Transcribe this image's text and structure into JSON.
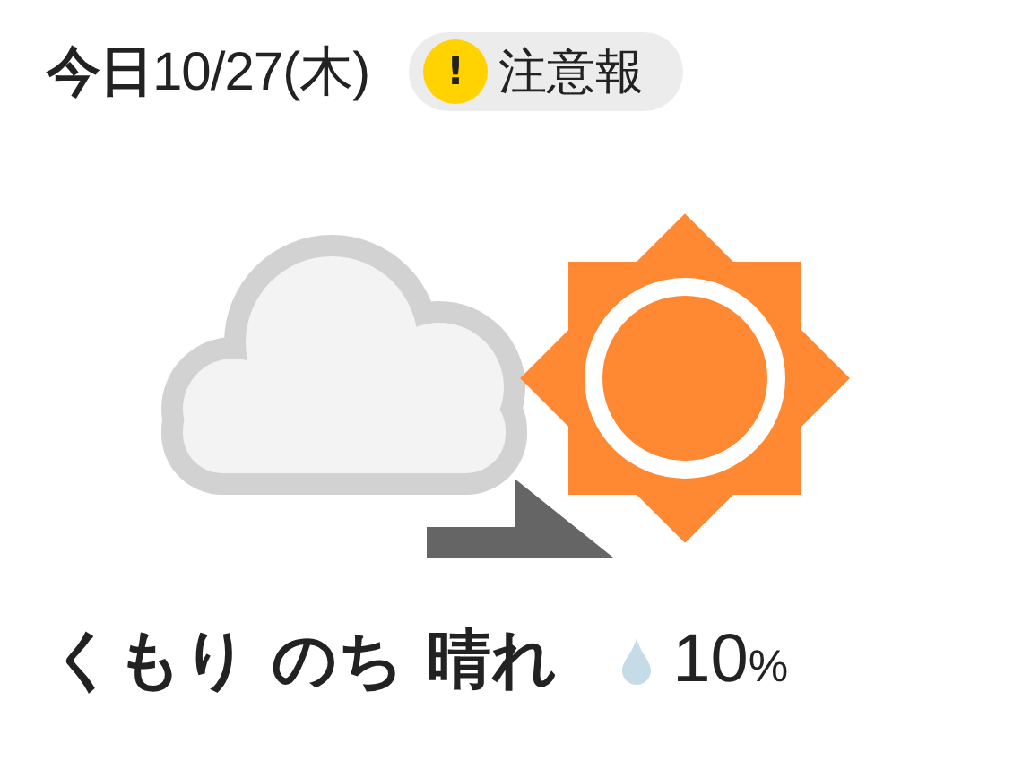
{
  "header": {
    "date": "**今日**10/27(木)",
    "badge": {
      "icon": "!",
      "label": "注意報"
    }
  },
  "forecast": {
    "weather": "くもり のち 晴れ",
    "precipitation": {
      "value": "10",
      "unit": "%"
    }
  }
}
